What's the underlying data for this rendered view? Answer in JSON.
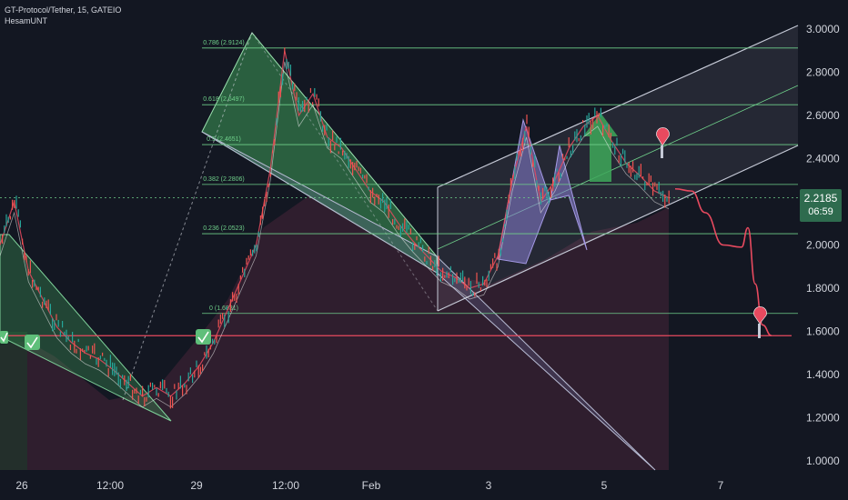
{
  "header": {
    "symbol_line": "GT-Protocol/Tether, 15, GATEIO",
    "author": "HesamUNT"
  },
  "colors": {
    "background": "#131722",
    "price_label_bg": "#2e6b4e",
    "axis_text": "#d1d4dc",
    "fib_line": "#6fcf8a",
    "target_line": "#e84a5f",
    "channel": "#c5c9d6",
    "triangle_fill": "#3e9b58",
    "pattern_fill": "#8a7fd4",
    "forecast_path": "#e84a5f"
  },
  "chart_data": {
    "type": "line",
    "y_axis": {
      "ticks": [
        "3.0000",
        "2.8000",
        "2.6000",
        "2.4000",
        "2.2000",
        "2.0000",
        "1.8000",
        "1.6000",
        "1.4000",
        "1.2000",
        "1.0000"
      ],
      "ylim": [
        0.95,
        3.1
      ]
    },
    "x_axis": {
      "ticks": [
        "26",
        "12:00",
        "29",
        "12:00",
        "Feb",
        "3",
        "5",
        "7"
      ]
    },
    "last_price": "2.2185",
    "countdown": "06:59",
    "fib_levels": [
      {
        "label": "0.786 (2.9124)",
        "value": 2.9124
      },
      {
        "label": "0.618 (2.6497)",
        "value": 2.6497
      },
      {
        "label": "0.5 (2.4651)",
        "value": 2.4651
      },
      {
        "label": "0.382 (2.2806)",
        "value": 2.2806
      },
      {
        "label": "0.236 (2.0523)",
        "value": 2.0523
      },
      {
        "label": "0 (1.6831)",
        "value": 1.6831
      }
    ],
    "target_line": 1.58,
    "series": [
      {
        "values": [
          2.0,
          2.2,
          1.88,
          1.75,
          1.62,
          1.55,
          1.5,
          1.47,
          1.42,
          1.36,
          1.3,
          1.34,
          1.3,
          1.36,
          1.44,
          1.55,
          1.7,
          1.85,
          2.0,
          2.35,
          2.9,
          2.6,
          2.7,
          2.5,
          2.45,
          2.35,
          2.25,
          2.2,
          2.1,
          2.02,
          1.95,
          1.88,
          1.85,
          1.8,
          1.82,
          1.95,
          2.3,
          2.55,
          2.2,
          2.3,
          2.45,
          2.55,
          2.6,
          2.48,
          2.38,
          2.32,
          2.25,
          2.2185
        ]
      }
    ],
    "forecast_path": [
      2.26,
      2.25,
      2.15,
      2.0,
      1.99,
      2.08,
      1.82,
      1.63,
      1.58
    ]
  }
}
